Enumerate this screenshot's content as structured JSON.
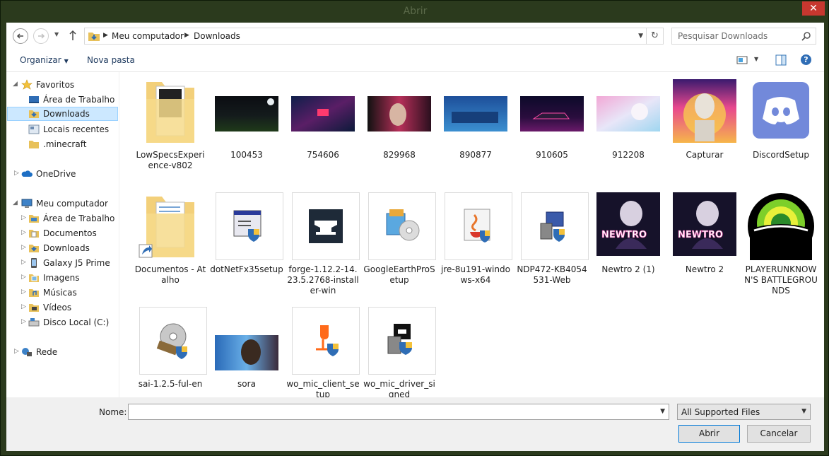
{
  "window": {
    "title": "Abrir",
    "close_glyph": "✕"
  },
  "address": {
    "crumbs": [
      "Meu computador",
      "Downloads"
    ],
    "separator": "▶"
  },
  "search": {
    "placeholder": "Pesquisar Downloads"
  },
  "toolbar": {
    "organize_label": "Organizar",
    "new_folder_label": "Nova pasta",
    "help_glyph": "?"
  },
  "sidebar": {
    "favorites": {
      "label": "Favoritos",
      "items": [
        {
          "label": "Área de Trabalho",
          "icon": "desktop-icon"
        },
        {
          "label": "Downloads",
          "icon": "downloads-folder-icon",
          "selected": true
        },
        {
          "label": "Locais recentes",
          "icon": "recent-places-icon"
        },
        {
          "label": ".minecraft",
          "icon": "folder-icon"
        }
      ]
    },
    "onedrive": {
      "label": "OneDrive"
    },
    "computer": {
      "label": "Meu computador",
      "items": [
        {
          "label": "Área de Trabalho"
        },
        {
          "label": "Documentos"
        },
        {
          "label": "Downloads"
        },
        {
          "label": "Galaxy J5 Prime"
        },
        {
          "label": "Imagens"
        },
        {
          "label": "Músicas"
        },
        {
          "label": "Vídeos"
        },
        {
          "label": "Disco Local (C:)"
        }
      ]
    },
    "network": {
      "label": "Rede"
    }
  },
  "files": [
    {
      "name": "LowSpecsExperience-v802",
      "kind": "folder"
    },
    {
      "name": "100453",
      "kind": "image"
    },
    {
      "name": "754606",
      "kind": "image"
    },
    {
      "name": "829968",
      "kind": "image"
    },
    {
      "name": "890877",
      "kind": "image"
    },
    {
      "name": "910605",
      "kind": "image"
    },
    {
      "name": "912208",
      "kind": "image"
    },
    {
      "name": "Capturar",
      "kind": "image"
    },
    {
      "name": "DiscordSetup",
      "kind": "exe"
    },
    {
      "name": "Documentos - Atalho",
      "kind": "shortcut"
    },
    {
      "name": "dotNetFx35setup",
      "kind": "exe"
    },
    {
      "name": "forge-1.12.2-14.23.5.2768-installer-win",
      "kind": "exe"
    },
    {
      "name": "GoogleEarthProSetup",
      "kind": "exe"
    },
    {
      "name": "jre-8u191-windows-x64",
      "kind": "exe"
    },
    {
      "name": "NDP472-KB4054531-Web",
      "kind": "exe"
    },
    {
      "name": "Newtro 2 (1)",
      "kind": "image"
    },
    {
      "name": "Newtro 2",
      "kind": "image"
    },
    {
      "name": "PLAYERUNKNOWN'S BATTLEGROUNDS",
      "kind": "shortcut"
    },
    {
      "name": "sai-1.2.5-ful-en",
      "kind": "exe"
    },
    {
      "name": "sora",
      "kind": "image"
    },
    {
      "name": "wo_mic_client_setup",
      "kind": "exe"
    },
    {
      "name": "wo_mic_driver_signed",
      "kind": "exe"
    }
  ],
  "thumb_text": {
    "newtro": "NEWTRO"
  },
  "bottom": {
    "name_label": "Nome:",
    "name_value": "",
    "filter_value": "All Supported Files",
    "open_label": "Abrir",
    "cancel_label": "Cancelar"
  },
  "colors": {
    "selection": "#cce8ff",
    "accent": "#0078d7",
    "window_frame": "#2b3a1d"
  }
}
